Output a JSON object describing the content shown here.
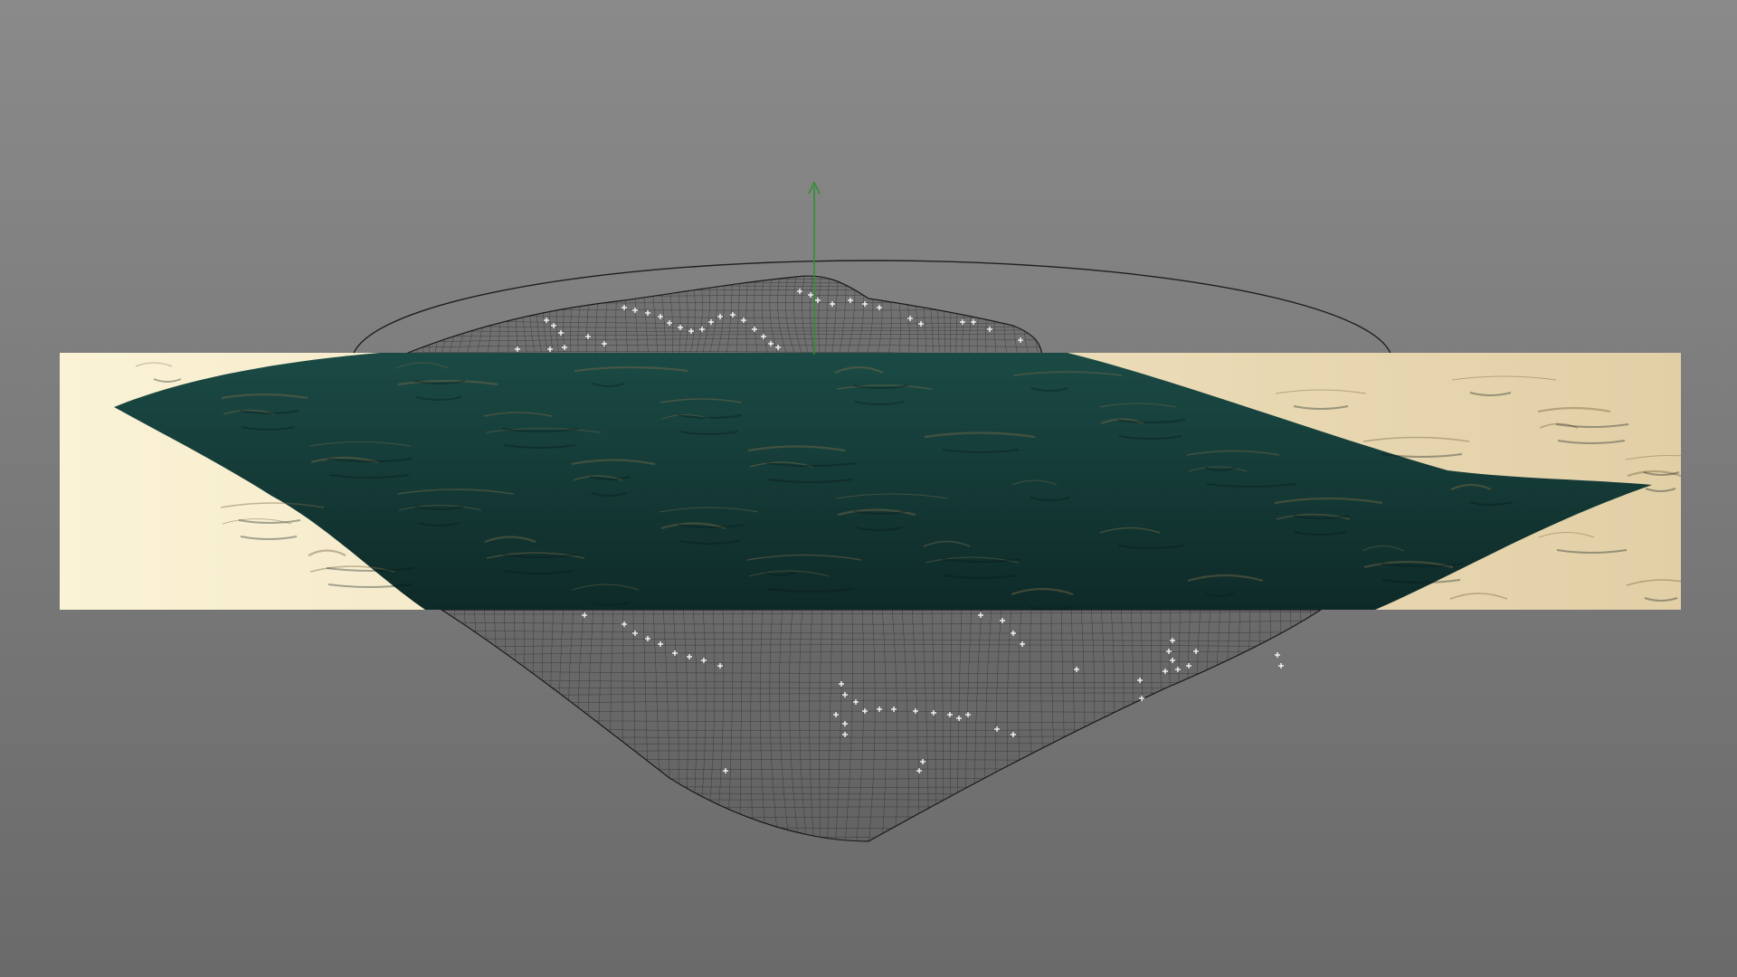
{
  "app": {
    "window": "3d-viewport",
    "mode": "ocean-surface-render-region-preview"
  },
  "colors": {
    "viewport_bg_top": "#8a8a8a",
    "viewport_bg_bottom": "#6a6a6a",
    "render_region_left": "#fbf3d6",
    "render_region_right": "#e2cfa6",
    "ocean_deep": "#0e2a28",
    "ocean_mid": "#1b4a45",
    "ocean_highlight": "#7a6a48",
    "wireframe": "#1a1a1a",
    "selected_vertices": "#ffffff",
    "gizmo_y_axis": "#2f8f2f",
    "gizmo_circle": "#1f1f1f"
  },
  "icons": {
    "gizmo": "move-gizmo-y-axis-icon",
    "vertex_marker": "vertex-cross-icon"
  }
}
